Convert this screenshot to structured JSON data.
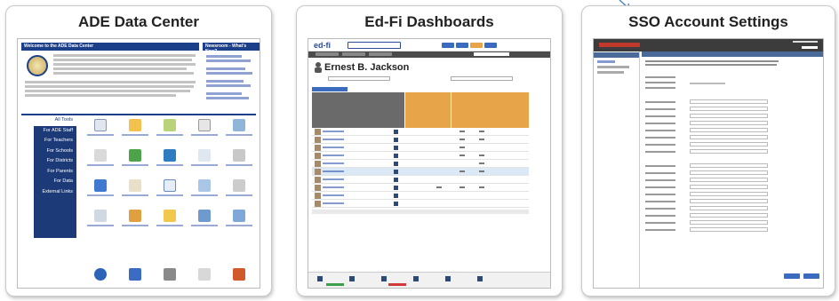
{
  "cards": [
    {
      "title": "ADE Data Center",
      "welcome_heading": "Welcome to the ADE Data Center",
      "news_heading": "Newsroom - What's New?",
      "tools_menu": [
        "All Tools",
        "For ADE Staff",
        "For Teachers",
        "For Schools",
        "For Districts",
        "For Parents",
        "For Data",
        "External Links"
      ]
    },
    {
      "title": "Ed-Fi Dashboards",
      "logo_text": "ed-fi",
      "student_name": "Ernest B. Jackson"
    },
    {
      "title": "SSO Account Settings"
    }
  ],
  "colors": {
    "ade_navy": "#1d3a78",
    "edfi_orange": "#e8a448",
    "edfi_gray": "#4b4b4b",
    "sso_header": "#3c3c3c",
    "sso_section": "#4a6a9a",
    "arrow": "#4a7fc1"
  }
}
